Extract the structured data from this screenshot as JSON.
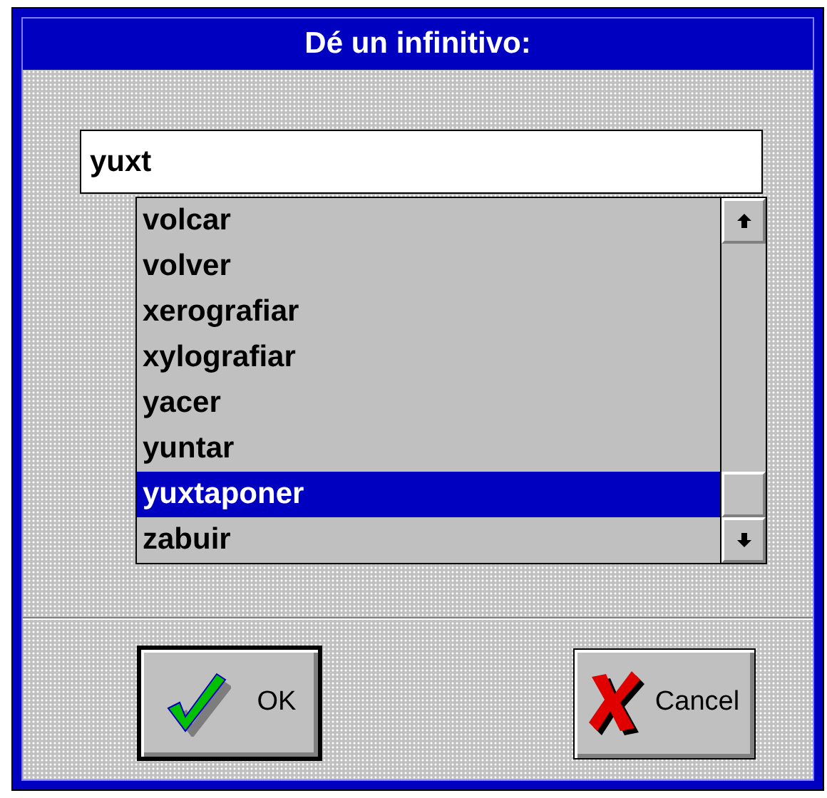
{
  "window": {
    "title": "Dé un infinitivo:"
  },
  "input": {
    "value": "yuxt"
  },
  "list": {
    "items": [
      {
        "label": "volcar",
        "selected": false
      },
      {
        "label": "volver",
        "selected": false
      },
      {
        "label": "xerografiar",
        "selected": false
      },
      {
        "label": "xylografiar",
        "selected": false
      },
      {
        "label": "yacer",
        "selected": false
      },
      {
        "label": "yuntar",
        "selected": false
      },
      {
        "label": "yuxtaponer",
        "selected": true
      },
      {
        "label": "zabuir",
        "selected": false
      }
    ]
  },
  "buttons": [
    {
      "label": "OK",
      "kind": "ok",
      "default": true
    },
    {
      "label": "Cancel",
      "kind": "cancel",
      "default": false
    }
  ]
}
